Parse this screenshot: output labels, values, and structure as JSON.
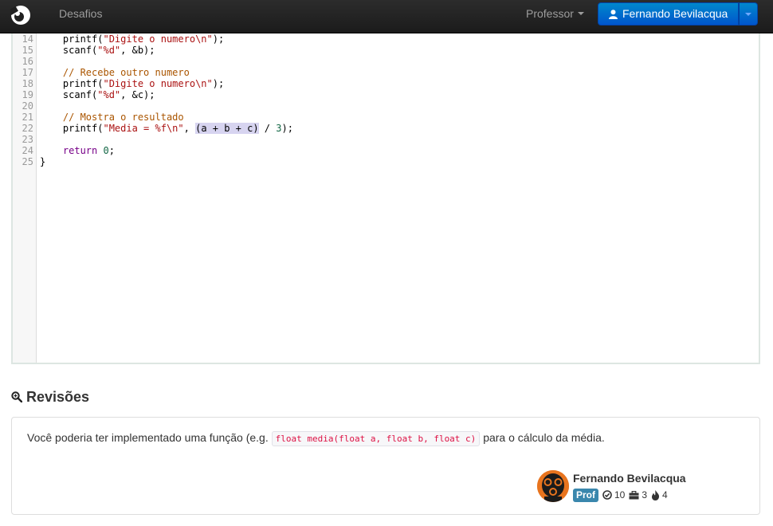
{
  "navbar": {
    "brand_icon": "circle-logo-icon",
    "link_desafios": "Desafios",
    "link_professor": "Professor",
    "user_button": "Fernando Bevilacqua",
    "user_icon": "user-icon"
  },
  "editor": {
    "line_numbers": [
      "14",
      "15",
      "16",
      "17",
      "18",
      "19",
      "20",
      "21",
      "22",
      "23",
      "24",
      "25"
    ],
    "lines": [
      [
        {
          "t": "    printf(",
          "c": ""
        },
        {
          "t": "\"Digite o numero\\n\"",
          "c": "str"
        },
        {
          "t": ");",
          "c": ""
        }
      ],
      [
        {
          "t": "    scanf(",
          "c": ""
        },
        {
          "t": "\"%d\"",
          "c": "str"
        },
        {
          "t": ", &b);",
          "c": ""
        }
      ],
      [],
      [
        {
          "t": "    ",
          "c": ""
        },
        {
          "t": "// Recebe outro numero",
          "c": "comment"
        }
      ],
      [
        {
          "t": "    printf(",
          "c": ""
        },
        {
          "t": "\"Digite o numero\\n\"",
          "c": "str"
        },
        {
          "t": ");",
          "c": ""
        }
      ],
      [
        {
          "t": "    scanf(",
          "c": ""
        },
        {
          "t": "\"%d\"",
          "c": "str"
        },
        {
          "t": ", &c);",
          "c": ""
        }
      ],
      [],
      [
        {
          "t": "    ",
          "c": ""
        },
        {
          "t": "// Mostra o resultado",
          "c": "comment"
        }
      ],
      [
        {
          "t": "    printf(",
          "c": ""
        },
        {
          "t": "\"Media = %f\\n\"",
          "c": "str"
        },
        {
          "t": ", ",
          "c": ""
        },
        {
          "t": "(a + b + c)",
          "c": "hl"
        },
        {
          "t": " / ",
          "c": ""
        },
        {
          "t": "3",
          "c": "num"
        },
        {
          "t": ");",
          "c": ""
        }
      ],
      [],
      [
        {
          "t": "    ",
          "c": ""
        },
        {
          "t": "return",
          "c": "kw"
        },
        {
          "t": " ",
          "c": ""
        },
        {
          "t": "0",
          "c": "num"
        },
        {
          "t": ";",
          "c": ""
        }
      ],
      [
        {
          "t": "}",
          "c": ""
        }
      ]
    ]
  },
  "revisions": {
    "title": "Revisões",
    "icon": "zoom-in-icon",
    "comment_before": "Você poderia ter implementado uma função (e.g. ",
    "comment_code": "float media(float a, float b, float c)",
    "comment_after": " para o cálculo da média.",
    "author": {
      "name": "Fernando Bevilacqua",
      "badge": "Prof",
      "stat_ok": "10",
      "stat_briefcase": "3",
      "stat_fire": "4"
    }
  },
  "colors": {
    "navbar_bg": "#222222",
    "user_button_bg": "#0066cc",
    "badge_bg": "#3a87ad",
    "avatar_bg": "#e8741e"
  }
}
